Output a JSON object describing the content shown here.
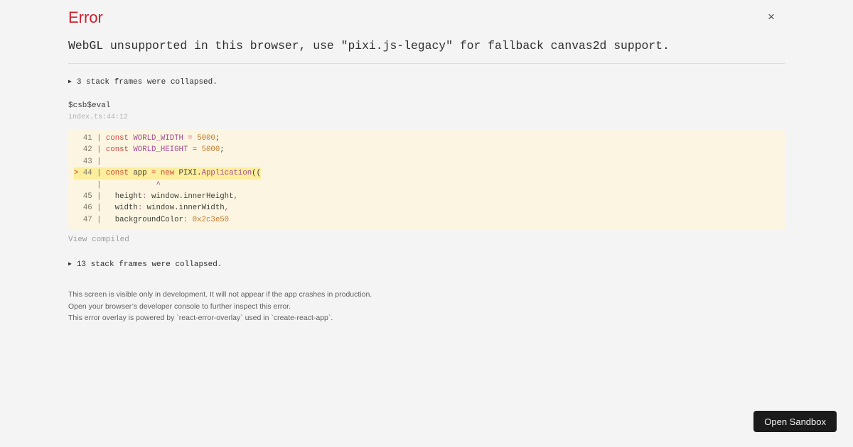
{
  "overlay": {
    "title": "Error",
    "message": "WebGL unsupported in this browser, use \"pixi.js-legacy\" for fallback canvas2d support."
  },
  "icons": {
    "close_glyph": "×",
    "collapse_triangle": "▶"
  },
  "stack": {
    "collapsed_top": "3 stack frames were collapsed.",
    "frame_fn": "$csb$eval",
    "frame_loc": "index.ts:44:12",
    "view_compiled": "View compiled",
    "collapsed_bottom": "13 stack frames were collapsed."
  },
  "code_frame": {
    "lines": [
      {
        "highlight": false,
        "segments": [
          [
            "linenum",
            "  41 | "
          ],
          [
            "keyword",
            "const "
          ],
          [
            "classname",
            "WORLD_WIDTH "
          ],
          [
            "keyword",
            "= "
          ],
          [
            "number",
            "5000"
          ],
          [
            "plain",
            ";"
          ]
        ]
      },
      {
        "highlight": false,
        "segments": [
          [
            "linenum",
            "  42 | "
          ],
          [
            "keyword",
            "const "
          ],
          [
            "classname",
            "WORLD_HEIGHT "
          ],
          [
            "keyword",
            "= "
          ],
          [
            "number",
            "5000"
          ],
          [
            "plain",
            ";"
          ]
        ]
      },
      {
        "highlight": false,
        "segments": [
          [
            "linenum",
            "  43 |"
          ]
        ]
      },
      {
        "highlight": true,
        "segments": [
          [
            "marker",
            "> "
          ],
          [
            "linenum",
            "44 | "
          ],
          [
            "keyword",
            "const "
          ],
          [
            "plain",
            "app "
          ],
          [
            "keyword",
            "= new "
          ],
          [
            "plain",
            "PIXI."
          ],
          [
            "classname",
            "Application"
          ],
          [
            "plain",
            "(("
          ]
        ]
      },
      {
        "highlight": false,
        "segments": [
          [
            "linenum",
            "     |"
          ],
          [
            "plain",
            "            "
          ],
          [
            "caret",
            "^"
          ]
        ]
      },
      {
        "highlight": false,
        "segments": [
          [
            "linenum",
            "  45 | "
          ],
          [
            "plain",
            "  height"
          ],
          [
            "punct",
            ": "
          ],
          [
            "plain",
            "window.innerHeight"
          ],
          [
            "punct",
            ","
          ]
        ]
      },
      {
        "highlight": false,
        "segments": [
          [
            "linenum",
            "  46 | "
          ],
          [
            "plain",
            "  width"
          ],
          [
            "punct",
            ": "
          ],
          [
            "plain",
            "window.innerWidth"
          ],
          [
            "punct",
            ","
          ]
        ]
      },
      {
        "highlight": false,
        "segments": [
          [
            "linenum",
            "  47 | "
          ],
          [
            "plain",
            "  backgroundColor"
          ],
          [
            "punct",
            ": "
          ],
          [
            "number",
            "0x2c3e50"
          ]
        ]
      }
    ]
  },
  "footer": {
    "lines": [
      "This screen is visible only in development. It will not appear if the app crashes in production.",
      "Open your browser’s developer console to further inspect this error.",
      "This error overlay is powered by `react-error-overlay` used in `create-react-app`."
    ]
  },
  "sandbox_button": {
    "label": "Open Sandbox"
  },
  "colors": {
    "page_bg": "#f4f4f4",
    "title_red": "#ce2130",
    "code_bg": "#fbf5e2",
    "highlight_bg": "#fcee9d",
    "keyword": "#d0483e",
    "classname": "#a74a94",
    "number": "#c07b2f",
    "punctuation": "#a85a7a",
    "plain_code": "#403e36",
    "line_number": "#7a7668",
    "marker": "#cf3e3e",
    "button_bg": "#1b1b1b"
  }
}
